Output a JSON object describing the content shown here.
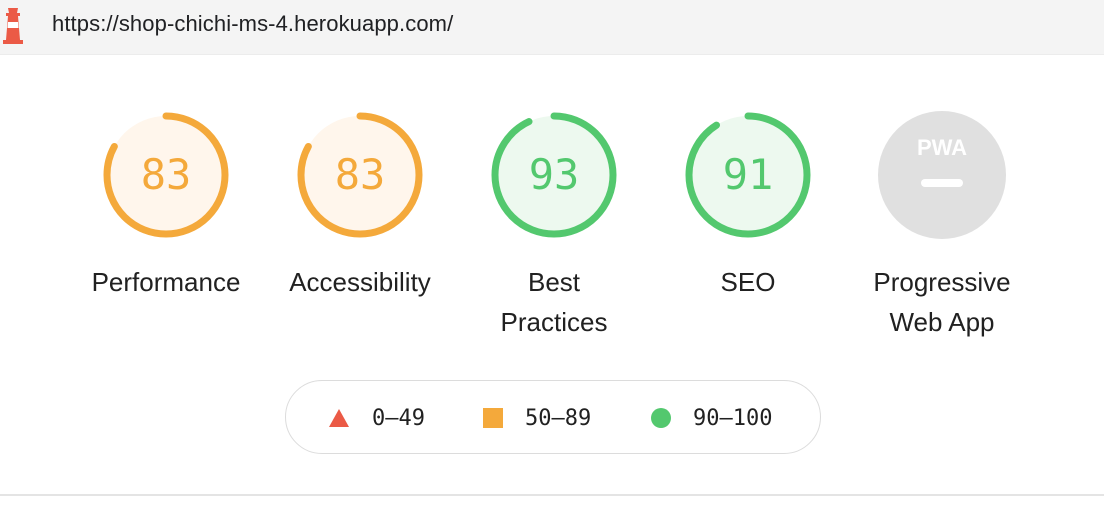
{
  "url_bar": {
    "url": "https://shop-chichi-ms-4.herokuapp.com/",
    "logo_icon": "lighthouse-icon"
  },
  "gauges": [
    {
      "label_lines": [
        "Performance"
      ],
      "score": "83",
      "fraction": 0.83,
      "rating": "average"
    },
    {
      "label_lines": [
        "Accessibility"
      ],
      "score": "83",
      "fraction": 0.83,
      "rating": "average"
    },
    {
      "label_lines": [
        "Best",
        "Practices"
      ],
      "score": "93",
      "fraction": 0.93,
      "rating": "pass"
    },
    {
      "label_lines": [
        "SEO"
      ],
      "score": "91",
      "fraction": 0.91,
      "rating": "pass"
    },
    {
      "label_lines": [
        "Progressive",
        "Web App"
      ],
      "badge": "PWA",
      "rating": "na"
    }
  ],
  "legend": {
    "fail": "0–49",
    "average": "50–89",
    "pass": "90–100"
  },
  "colors": {
    "fail": "#eb5a46",
    "average": "#f4a93b",
    "average_bg": "#fff6ec",
    "pass": "#53c86e",
    "pass_bg": "#edf9ef",
    "na": "#e0e0e0",
    "na_text": "#ffffff"
  }
}
